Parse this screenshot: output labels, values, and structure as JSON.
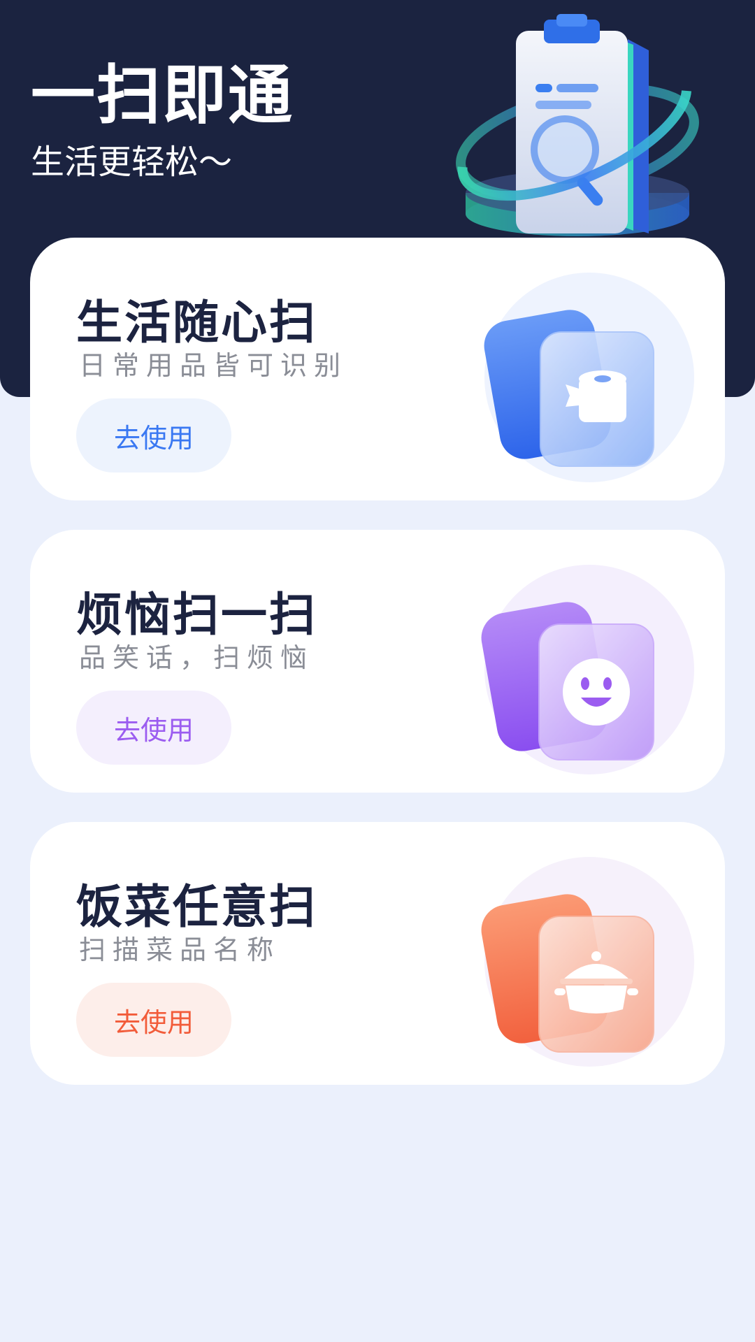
{
  "header": {
    "title": "一扫即通",
    "subtitle": "生活更轻松～",
    "illustration_icon": "clipboard-magnifier-icon"
  },
  "cards": [
    {
      "title": "生活随心扫",
      "description": "日常用品皆可识别",
      "button_label": "去使用",
      "icon": "paper-roll-icon",
      "accent": "#3a78f2",
      "button_bg": "#edf3fd"
    },
    {
      "title": "烦恼扫一扫",
      "description": "品笑话，扫烦恼",
      "button_label": "去使用",
      "icon": "smiley-icon",
      "accent": "#9b5cf0",
      "button_bg": "#f4effd"
    },
    {
      "title": "饭菜任意扫",
      "description": "扫描菜品名称",
      "button_label": "去使用",
      "icon": "cooking-pot-icon",
      "accent": "#f25c3a",
      "button_bg": "#fdeeea"
    }
  ],
  "colors": {
    "header_bg": "#1b2340",
    "page_bg": "#ebf0fc",
    "title_text": "#1c2340"
  }
}
